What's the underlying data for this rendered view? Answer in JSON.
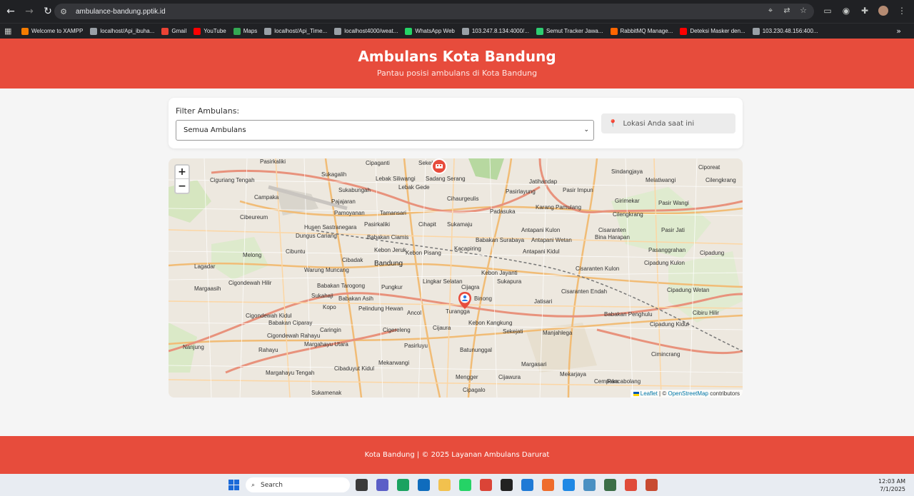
{
  "browser": {
    "url": "ambulance-bandung.pptik.id",
    "bookmarks": [
      {
        "label": "Welcome to XAMPP",
        "color": "#f57c00"
      },
      {
        "label": "localhost/Api_ibuha...",
        "color": "#9aa0a6"
      },
      {
        "label": "Gmail",
        "color": "#ea4335"
      },
      {
        "label": "YouTube",
        "color": "#ff0000"
      },
      {
        "label": "Maps",
        "color": "#34a853"
      },
      {
        "label": "localhost/Api_Time...",
        "color": "#9aa0a6"
      },
      {
        "label": "localhost4000/weat...",
        "color": "#9aa0a6"
      },
      {
        "label": "WhatsApp Web",
        "color": "#25d366"
      },
      {
        "label": "103.247.8.134:4000/...",
        "color": "#9aa0a6"
      },
      {
        "label": "Semut Tracker Jawa...",
        "color": "#2ecc71"
      },
      {
        "label": "RabbitMQ Manage...",
        "color": "#ff6600"
      },
      {
        "label": "Deteksi Masker den...",
        "color": "#ff0000"
      },
      {
        "label": "103.230.48.156:400...",
        "color": "#9aa0a6"
      }
    ]
  },
  "header": {
    "title": "Ambulans Kota Bandung",
    "subtitle": "Pantau posisi ambulans di Kota Bandung"
  },
  "filter": {
    "label": "Filter Ambulans:",
    "selected": "Semua Ambulans",
    "location_text": "Lokasi Anda saat ini"
  },
  "map": {
    "zoom_in": "+",
    "zoom_out": "−",
    "attribution_leaflet": "Leaflet",
    "attribution_sep": "| ©",
    "attribution_osm": "OpenStreetMap",
    "attribution_tail": "contributors",
    "labels": [
      {
        "text": "Pasirkaliki"
      },
      {
        "text": "Cipaganti"
      },
      {
        "text": "Sekeloa"
      },
      {
        "text": "Sukagalih"
      },
      {
        "text": "Lebak Siliwangi"
      },
      {
        "text": "Sadang Serang"
      },
      {
        "text": "Jatihandap"
      },
      {
        "text": "Sindangjaya"
      },
      {
        "text": "Ciporeat"
      },
      {
        "text": "Cilengkrang"
      },
      {
        "text": "Ciguriang Tengah"
      },
      {
        "text": "Sukabungah"
      },
      {
        "text": "Lebak Gede"
      },
      {
        "text": "Pasirlayung"
      },
      {
        "text": "Pasir Impun"
      },
      {
        "text": "Melatiwangi"
      },
      {
        "text": "Campaka"
      },
      {
        "text": "Pajajaran"
      },
      {
        "text": "Cihaurgeulis"
      },
      {
        "text": "Girimekar"
      },
      {
        "text": "Pasir Wangi"
      },
      {
        "text": "Pamoyanan"
      },
      {
        "text": "Tamansari"
      },
      {
        "text": "Padasuka"
      },
      {
        "text": "Karang Pamulang"
      },
      {
        "text": "Cilengkrang"
      },
      {
        "text": "Cibeureum"
      },
      {
        "text": "Husen Sastranegara"
      },
      {
        "text": "Pasirkaliki"
      },
      {
        "text": "Cihapit"
      },
      {
        "text": "Sukamaju"
      },
      {
        "text": "Cisaranten"
      },
      {
        "text": "Bina Harapan"
      },
      {
        "text": "Pasir Jati"
      },
      {
        "text": "Dungus Cariang"
      },
      {
        "text": "Babakan Ciamis"
      },
      {
        "text": "Babakan Surabaya"
      },
      {
        "text": "Antapani Kulon"
      },
      {
        "text": "Antapani Wetan"
      },
      {
        "text": "Kebon Jeruk"
      },
      {
        "text": "Kebon Pisang"
      },
      {
        "text": "Kacapiring"
      },
      {
        "text": "Pasanggrahan"
      },
      {
        "text": "Melong"
      },
      {
        "text": "Cibuntu"
      },
      {
        "text": "Cibadak"
      },
      {
        "text": "Bandung"
      },
      {
        "text": "Antapani Kidul"
      },
      {
        "text": "Cipadung"
      },
      {
        "text": "Lagadar"
      },
      {
        "text": "Warung Muncang"
      },
      {
        "text": "Kebon Jayanti"
      },
      {
        "text": "Cisaranten Kulon"
      },
      {
        "text": "Cipadung Kulon"
      },
      {
        "text": "Margaasih"
      },
      {
        "text": "Cigondewah Hilir"
      },
      {
        "text": "Babakan Tarogong"
      },
      {
        "text": "Pungkur"
      },
      {
        "text": "Lingkar Selatan"
      },
      {
        "text": "Sukapura"
      },
      {
        "text": "Cisaranten Endah"
      },
      {
        "text": "Cipadung Wetan"
      },
      {
        "text": "Sukahaji"
      },
      {
        "text": "Babakan Asih"
      },
      {
        "text": "Cijagra"
      },
      {
        "text": "Binong"
      },
      {
        "text": "Jatisari"
      },
      {
        "text": "Kopo"
      },
      {
        "text": "Pelindung Hewan"
      },
      {
        "text": "Ancol"
      },
      {
        "text": "Turangga"
      },
      {
        "text": "Babakan Penghulu"
      },
      {
        "text": "Cibiru Hilir"
      },
      {
        "text": "Cigondewah Kidul"
      },
      {
        "text": "Babakan Ciparay"
      },
      {
        "text": "Caringin"
      },
      {
        "text": "Cigereleng"
      },
      {
        "text": "Cijaura"
      },
      {
        "text": "Kebon Kangkung"
      },
      {
        "text": "Sekejati"
      },
      {
        "text": "Cipadung Kidul"
      },
      {
        "text": "Cigondewah Rahayu"
      },
      {
        "text": "Margahayu Utara"
      },
      {
        "text": "Manjahlega"
      },
      {
        "text": "Nanjung"
      },
      {
        "text": "Rahayu"
      },
      {
        "text": "Pasirluyu"
      },
      {
        "text": "Batununggal"
      },
      {
        "text": "Cimincrang"
      },
      {
        "text": "Mekarwangi"
      },
      {
        "text": "Margasari"
      },
      {
        "text": "Cibaduyut Kidul"
      },
      {
        "text": "Margahayu Tengah"
      },
      {
        "text": "Mengger"
      },
      {
        "text": "Cijawura"
      },
      {
        "text": "Mekarjaya"
      },
      {
        "text": "Cempaka"
      },
      {
        "text": "Rancabolang"
      },
      {
        "text": "Cipagalo"
      },
      {
        "text": "Sukamenak"
      }
    ]
  },
  "footer": {
    "text": "Kota Bandung | © 2025 Layanan Ambulans Darurat"
  },
  "taskbar": {
    "search_label": "Search",
    "time": "12:03 AM",
    "date": "7/1/2025"
  },
  "colors": {
    "brand": "#e74c3c"
  }
}
